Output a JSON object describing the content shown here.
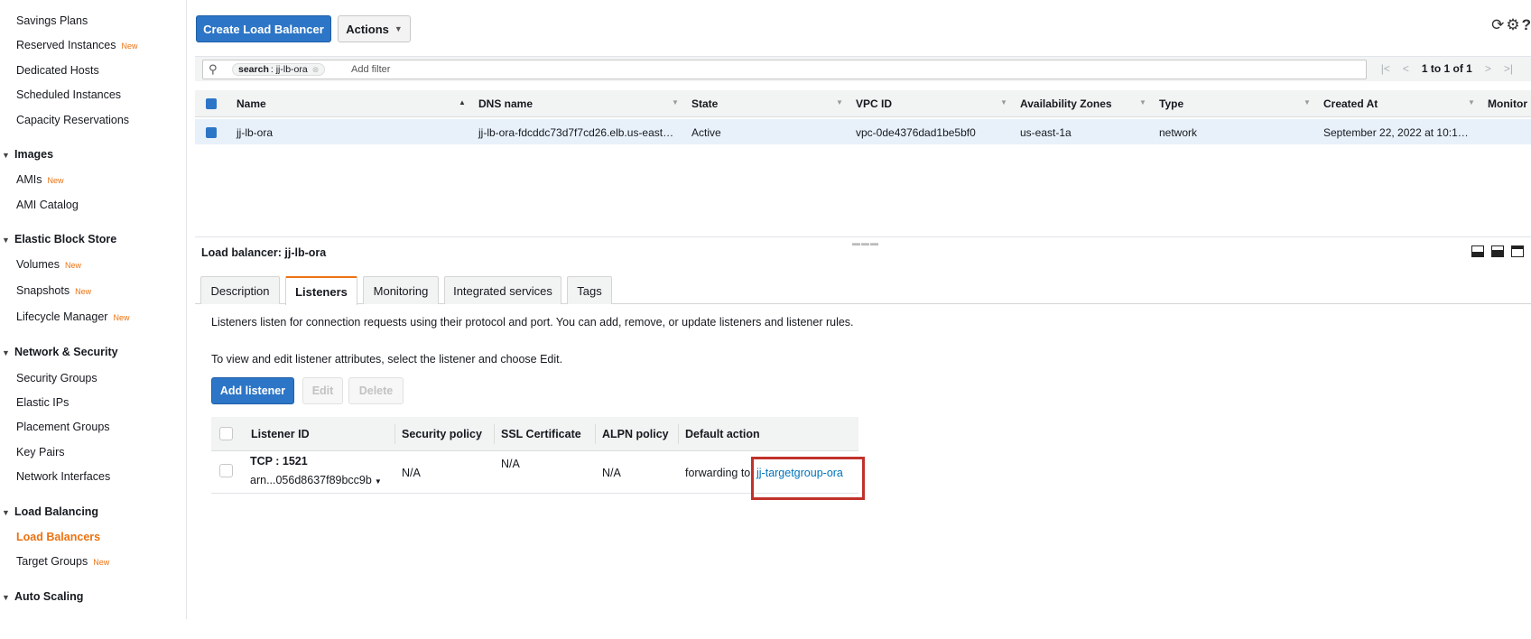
{
  "sidebar": {
    "items_top": [
      {
        "label": "Savings Plans",
        "badge": ""
      },
      {
        "label": "Reserved Instances",
        "badge": "New"
      },
      {
        "label": "Dedicated Hosts",
        "badge": ""
      },
      {
        "label": "Scheduled Instances",
        "badge": ""
      },
      {
        "label": "Capacity Reservations",
        "badge": ""
      }
    ],
    "images": {
      "title": "Images",
      "items": [
        {
          "label": "AMIs",
          "badge": "New"
        },
        {
          "label": "AMI Catalog",
          "badge": ""
        }
      ]
    },
    "ebs": {
      "title": "Elastic Block Store",
      "items": [
        {
          "label": "Volumes",
          "badge": "New"
        },
        {
          "label": "Snapshots",
          "badge": "New"
        },
        {
          "label": "Lifecycle Manager",
          "badge": "New"
        }
      ]
    },
    "network": {
      "title": "Network & Security",
      "items": [
        {
          "label": "Security Groups",
          "badge": ""
        },
        {
          "label": "Elastic IPs",
          "badge": ""
        },
        {
          "label": "Placement Groups",
          "badge": ""
        },
        {
          "label": "Key Pairs",
          "badge": ""
        },
        {
          "label": "Network Interfaces",
          "badge": ""
        }
      ]
    },
    "lb": {
      "title": "Load Balancing",
      "items": [
        {
          "label": "Load Balancers",
          "badge": ""
        },
        {
          "label": "Target Groups",
          "badge": "New"
        }
      ]
    },
    "autoscaling": {
      "title": "Auto Scaling"
    }
  },
  "toolbar": {
    "create_label": "Create Load Balancer",
    "actions_label": "Actions",
    "refresh_icon": "refresh-icon",
    "settings_icon": "gear-icon",
    "help_icon": "help-icon"
  },
  "filter": {
    "token_key": "search",
    "token_value": " : jj-lb-ora",
    "add_filter_label": "Add filter",
    "pagination": "1 to 1 of 1"
  },
  "lb_table": {
    "columns": [
      "Name",
      "DNS name",
      "State",
      "VPC ID",
      "Availability Zones",
      "Type",
      "Created At",
      "Monitor"
    ],
    "rows": [
      [
        "jj-lb-ora",
        "jj-lb-ora-fdcddc73d7f7cd26.elb.us-east…",
        "Active",
        "vpc-0de4376dad1be5bf0",
        "us-east-1a",
        "network",
        "September 22, 2022 at 10:1…"
      ]
    ]
  },
  "detail": {
    "title": "Load balancer: jj-lb-ora",
    "tabs": [
      "Description",
      "Listeners",
      "Monitoring",
      "Integrated services",
      "Tags"
    ],
    "active_tab": "Listeners",
    "info_1": "Listeners listen for connection requests using their protocol and port. You can add, remove, or update listeners and listener rules.",
    "info_2": "To view and edit listener attributes, select the listener and choose Edit.",
    "add_listener_label": "Add listener",
    "edit_label": "Edit",
    "delete_label": "Delete"
  },
  "listener_table": {
    "columns": [
      "Listener ID",
      "Security policy",
      "SSL Certificate",
      "ALPN policy",
      "Default action"
    ],
    "rows": [
      {
        "listener_id": "TCP : 1521",
        "arn": "arn...056d8637f89bcc9b",
        "security_policy": "N/A",
        "ssl_certificate": "N/A",
        "alpn_policy": "N/A",
        "default_action_prefix": "forwarding to",
        "target_group": "jj-targetgroup-ora"
      }
    ]
  },
  "colors": {
    "accent": "#ec7211",
    "primary_button": "#2d75c6",
    "link": "#0073bb",
    "highlight": "#c0322b"
  }
}
